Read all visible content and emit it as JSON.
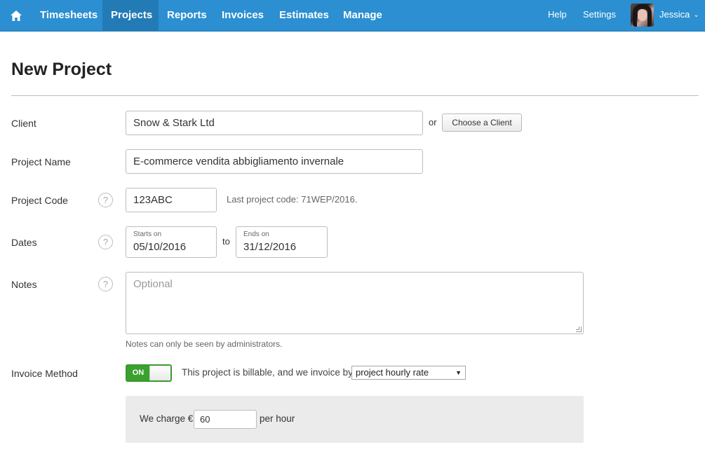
{
  "nav": {
    "items": [
      "Timesheets",
      "Projects",
      "Reports",
      "Invoices",
      "Estimates",
      "Manage"
    ],
    "active": "Projects",
    "help": "Help",
    "settings": "Settings",
    "user": "Jessica"
  },
  "page": {
    "title": "New Project"
  },
  "form": {
    "client": {
      "label": "Client",
      "value": "Snow & Stark Ltd",
      "or": "or",
      "choose_button": "Choose a Client"
    },
    "project_name": {
      "label": "Project Name",
      "value": "E-commerce vendita abbigliamento invernale"
    },
    "project_code": {
      "label": "Project Code",
      "value": "123ABC",
      "hint": "Last project code: 71WEP/2016.",
      "help": "?"
    },
    "dates": {
      "label": "Dates",
      "starts_caption": "Starts on",
      "starts_value": "05/10/2016",
      "to": "to",
      "ends_caption": "Ends on",
      "ends_value": "31/12/2016",
      "help": "?"
    },
    "notes": {
      "label": "Notes",
      "placeholder": "Optional",
      "hint": "Notes can only be seen by administrators.",
      "help": "?"
    },
    "invoice_method": {
      "label": "Invoice Method",
      "toggle": "ON",
      "text": "This project is billable, and we invoice by",
      "select_value": "project hourly rate",
      "charge_prefix": "We charge €",
      "charge_value": "60",
      "charge_suffix": "per hour"
    }
  },
  "colors": {
    "nav_bg": "#2b8fd1",
    "nav_active": "#237bb6",
    "toggle_on": "#3aa02e"
  }
}
